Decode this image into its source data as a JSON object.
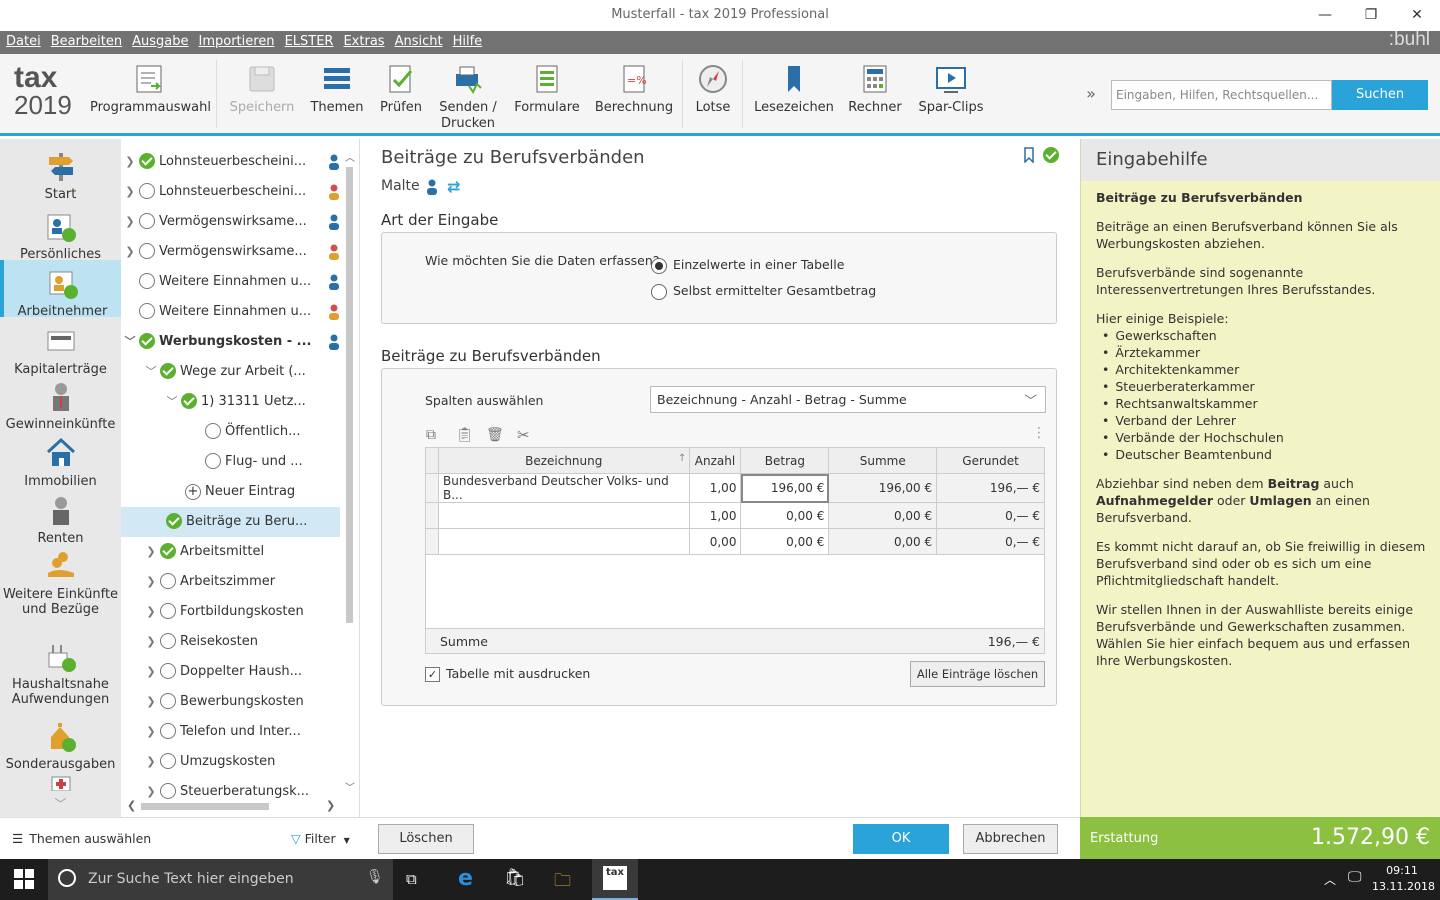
{
  "window": {
    "title": "Musterfall - tax 2019 Professional"
  },
  "menu": [
    "Datei",
    "Bearbeiten",
    "Ausgabe",
    "Importieren",
    "ELSTER",
    "Extras",
    "Ansicht",
    "Hilfe"
  ],
  "brand": ":buhl",
  "logo": {
    "line1": "tax",
    "line2": "2019"
  },
  "ribbon": {
    "programmauswahl": "Programmauswahl",
    "speichern": "Speichern",
    "themen": "Themen",
    "pruefen": "Prüfen",
    "senden": "Senden /",
    "drucken": "Drucken",
    "formulare": "Formulare",
    "berechnung": "Berechnung",
    "lotse": "Lotse",
    "lesezeichen": "Lesezeichen",
    "rechner": "Rechner",
    "sparclips": "Spar-Clips",
    "more": "»",
    "search_placeholder": "Eingaben, Hilfen, Rechtsquellen...",
    "search_button": "Suchen"
  },
  "sidebar": [
    {
      "label": "Start"
    },
    {
      "label": "Persönliches"
    },
    {
      "label": "Arbeitnehmer"
    },
    {
      "label": "Kapitalerträge"
    },
    {
      "label": "Gewinneinkünfte"
    },
    {
      "label": "Immobilien"
    },
    {
      "label": "Renten"
    },
    {
      "label": "Weitere Einkünfte",
      "label2": "und Bezüge"
    },
    {
      "label": "Haushaltsnahe",
      "label2": "Aufwendungen"
    },
    {
      "label": "Sonderausgaben"
    }
  ],
  "tree": [
    {
      "label": "Lohnsteuerbescheini..."
    },
    {
      "label": "Lohnsteuerbescheini..."
    },
    {
      "label": "Vermögenswirksame..."
    },
    {
      "label": "Vermögenswirksame..."
    },
    {
      "label": "Weitere Einnahmen u..."
    },
    {
      "label": "Weitere Einnahmen u..."
    },
    {
      "label": "Werbungskosten - ..."
    },
    {
      "label": "Wege zur Arbeit (..."
    },
    {
      "label": "1) 31311 Uetz..."
    },
    {
      "label": "Öffentlich..."
    },
    {
      "label": "Flug- und ..."
    },
    {
      "label": "Neuer Eintrag"
    },
    {
      "label": "Beiträge zu Beru..."
    },
    {
      "label": "Arbeitsmittel"
    },
    {
      "label": "Arbeitszimmer"
    },
    {
      "label": "Fortbildungskosten"
    },
    {
      "label": "Reisekosten"
    },
    {
      "label": "Doppelter Haush..."
    },
    {
      "label": "Bewerbungskosten"
    },
    {
      "label": "Telefon und Inter..."
    },
    {
      "label": "Umzugskosten"
    },
    {
      "label": "Steuerberatungsk..."
    }
  ],
  "content": {
    "title": "Beiträge zu Berufsverbänden",
    "person": "Malte",
    "art_heading": "Art der Eingabe",
    "question": "Wie möchten Sie die Daten erfassen?",
    "option1": "Einzelwerte in einer Tabelle",
    "option2": "Selbst ermittelter Gesamtbetrag",
    "table_heading": "Beiträge zu Berufsverbänden",
    "spalten_label": "Spalten auswählen",
    "spalten_value": "Bezeichnung - Anzahl - Betrag - Summe",
    "columns": [
      "Bezeichnung",
      "Anzahl",
      "Betrag",
      "Summe",
      "Gerundet"
    ],
    "rows": [
      {
        "bez": "Bundesverband Deutscher Volks- und B...",
        "anzahl": "1,00",
        "betrag": "196,00 €",
        "summe": "196,00 €",
        "gerundet": "196,— €"
      },
      {
        "bez": "",
        "anzahl": "1,00",
        "betrag": "0,00 €",
        "summe": "0,00 €",
        "gerundet": "0,— €"
      },
      {
        "bez": "",
        "anzahl": "0,00",
        "betrag": "0,00 €",
        "summe": "0,00 €",
        "gerundet": "0,— €"
      }
    ],
    "summe_label": "Summe",
    "summe_value": "196,— €",
    "print_label": "Tabelle mit ausdrucken",
    "clear_all": "Alle Einträge löschen"
  },
  "help": {
    "header": "Eingabehilfe",
    "title": "Beiträge zu Berufsverbänden",
    "p1": "Beiträge an einen Berufsverband können Sie als Werbungskosten abziehen.",
    "p2": "Berufsverbände sind sogenannte Interessenvertretungen Ihres Berufsstandes.",
    "p3": "Hier einige Beispiele:",
    "examples": [
      "Gewerkschaften",
      "Ärztekammer",
      "Architektenkammer",
      "Steuerberaterkammer",
      "Rechtsanwaltskammer",
      "Verband der Lehrer",
      "Verbände der Hochschulen",
      "Deutscher Beamtenbund"
    ],
    "p4a": "Abziehbar sind neben dem ",
    "p4b": "Beitrag",
    "p4c": " auch ",
    "p4d": "Aufnahmegelder",
    "p4e": " oder ",
    "p4f": "Umlagen",
    "p4g": " an einen Berufsverband.",
    "p5": "Es kommt nicht darauf an, ob Sie freiwillig in diesem Berufsverband sind oder ob es sich um eine Pflichtmitgliedschaft handelt.",
    "p6": "Wir stellen Ihnen in der Auswahlliste bereits einige Berufsverbände und Gewerkschaften zusammen. Wählen Sie hier einfach bequem aus und erfassen Ihre Werbungskosten."
  },
  "bottom": {
    "themen": "Themen auswählen",
    "filter": "Filter",
    "loeschen": "Löschen",
    "ok": "OK",
    "abbrechen": "Abbrechen",
    "erstattung_label": "Erstattung",
    "erstattung_value": "1.572,90 €"
  },
  "taskbar": {
    "search": "Zur Suche Text hier eingeben",
    "time": "09:11",
    "date": "13.11.2018",
    "app": "tax"
  },
  "colors": {
    "accent": "#2aa3d8",
    "ok": "#5cb030",
    "help_bg": "#f2f4c6",
    "erstattung": "#8cc040"
  }
}
